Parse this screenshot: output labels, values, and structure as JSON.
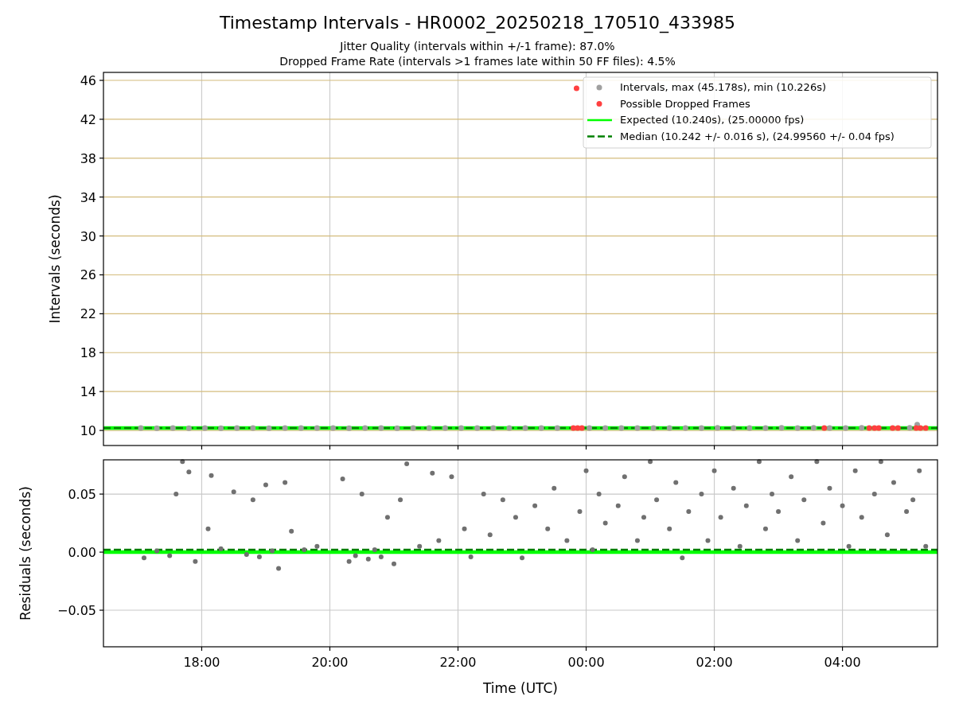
{
  "figure": {
    "title": "Timestamp Intervals - HR0002_20250218_170510_433985",
    "subtitles": [
      "Jitter Quality (intervals within +/-1 frame): 87.0%",
      "Dropped Frame Rate (intervals >1 frames late within 50 FF files): 4.5%"
    ]
  },
  "intervals_plot": {
    "chart_data": {
      "type": "scatter",
      "ylabel": "Intervals (seconds)",
      "grid": true,
      "legend": "upper right",
      "xlim": [
        "2025-02-18 16:28",
        "2025-02-19 05:29"
      ],
      "ylim": [
        8.45,
        46.82
      ],
      "yticks": [
        10,
        14,
        18,
        22,
        26,
        30,
        34,
        38,
        42,
        46
      ],
      "series": [
        {
          "name": "Intervals, max (45.178s), min (10.226s)",
          "type": "scatter",
          "color": "#a0a0a0",
          "x": [
            "2025-02-18 17:03",
            "2025-02-18 17:18",
            "2025-02-18 17:33",
            "2025-02-18 17:48",
            "2025-02-18 18:03",
            "2025-02-18 18:18",
            "2025-02-18 18:33",
            "2025-02-18 18:48",
            "2025-02-18 19:03",
            "2025-02-18 19:18",
            "2025-02-18 19:33",
            "2025-02-18 19:48",
            "2025-02-18 20:03",
            "2025-02-18 20:18",
            "2025-02-18 20:33",
            "2025-02-18 20:48",
            "2025-02-18 21:03",
            "2025-02-18 21:18",
            "2025-02-18 21:33",
            "2025-02-18 21:48",
            "2025-02-18 22:03",
            "2025-02-18 22:18",
            "2025-02-18 22:33",
            "2025-02-18 22:48",
            "2025-02-18 23:03",
            "2025-02-18 23:18",
            "2025-02-18 23:33",
            "2025-02-19 00:03",
            "2025-02-19 00:18",
            "2025-02-19 00:33",
            "2025-02-19 00:48",
            "2025-02-19 01:03",
            "2025-02-19 01:18",
            "2025-02-19 01:33",
            "2025-02-19 01:48",
            "2025-02-19 02:03",
            "2025-02-19 02:18",
            "2025-02-19 02:33",
            "2025-02-19 02:48",
            "2025-02-19 03:03",
            "2025-02-19 03:18",
            "2025-02-19 03:33",
            "2025-02-19 03:48",
            "2025-02-19 04:03",
            "2025-02-19 04:18",
            "2025-02-19 05:03",
            "2025-02-19 05:10"
          ],
          "values": [
            10.24,
            10.23,
            10.24,
            10.23,
            10.24,
            10.23,
            10.24,
            10.24,
            10.23,
            10.24,
            10.24,
            10.24,
            10.24,
            10.23,
            10.24,
            10.24,
            10.23,
            10.24,
            10.24,
            10.24,
            10.24,
            10.24,
            10.24,
            10.24,
            10.24,
            10.25,
            10.24,
            10.25,
            10.26,
            10.25,
            10.26,
            10.26,
            10.25,
            10.26,
            10.26,
            10.27,
            10.26,
            10.25,
            10.26,
            10.27,
            10.26,
            10.27,
            10.26,
            10.26,
            10.27,
            10.27,
            10.6
          ]
        },
        {
          "name": "Possible Dropped Frames",
          "type": "scatter",
          "color": "#ff4040",
          "x": [
            "2025-02-18 23:51",
            "2025-02-18 23:48",
            "2025-02-18 23:52",
            "2025-02-18 23:56",
            "2025-02-19 03:43",
            "2025-02-19 04:25",
            "2025-02-19 04:30",
            "2025-02-19 04:34",
            "2025-02-19 04:47",
            "2025-02-19 04:52",
            "2025-02-19 05:09",
            "2025-02-19 05:13",
            "2025-02-19 05:18"
          ],
          "values": [
            45.178,
            10.24,
            10.24,
            10.24,
            10.24,
            10.24,
            10.24,
            10.24,
            10.24,
            10.24,
            10.24,
            10.24,
            10.24
          ]
        },
        {
          "name": "Expected (10.240s), (25.00000 fps)",
          "type": "line",
          "color": "#00ff00",
          "x": [
            "2025-02-18 16:28",
            "2025-02-19 05:29"
          ],
          "values": [
            10.24,
            10.24
          ]
        },
        {
          "name": "Median (10.242 +/- 0.016 s), (24.99560 +/- 0.04 fps)",
          "type": "line",
          "color": "#008000",
          "line_style": "dashed",
          "x": [
            "2025-02-18 16:28",
            "2025-02-19 05:29"
          ],
          "values": [
            10.242,
            10.242
          ]
        }
      ]
    }
  },
  "residuals_plot": {
    "chart_data": {
      "type": "scatter",
      "xlabel": "Time (UTC)",
      "ylabel": "Residuals (seconds)",
      "grid": true,
      "xlim": [
        "2025-02-18 16:28",
        "2025-02-19 05:29"
      ],
      "ylim": [
        -0.0815,
        0.0795
      ],
      "xticks": [
        {
          "value": "2025-02-18 18:00",
          "label": "18:00"
        },
        {
          "value": "2025-02-18 20:00",
          "label": "20:00"
        },
        {
          "value": "2025-02-18 22:00",
          "label": "22:00"
        },
        {
          "value": "2025-02-19 00:00",
          "label": "00:00"
        },
        {
          "value": "2025-02-19 02:00",
          "label": "02:00"
        },
        {
          "value": "2025-02-19 04:00",
          "label": "04:00"
        }
      ],
      "yticks": [
        {
          "value": 0.05,
          "label": "0.05"
        },
        {
          "value": 0,
          "label": "0.00"
        },
        {
          "value": -0.05,
          "label": "−0.05"
        }
      ],
      "series": [
        {
          "type": "scatter",
          "color": "#707070",
          "x": [
            "2025-02-18 17:06",
            "2025-02-18 17:18",
            "2025-02-18 17:36",
            "2025-02-18 17:42",
            "2025-02-18 17:48",
            "2025-02-18 17:54",
            "2025-02-18 18:06",
            "2025-02-18 18:09",
            "2025-02-18 18:18",
            "2025-02-18 18:30",
            "2025-02-18 18:42",
            "2025-02-18 18:48",
            "2025-02-18 19:00",
            "2025-02-18 19:06",
            "2025-02-18 19:12",
            "2025-02-18 19:18",
            "2025-02-18 19:24",
            "2025-02-18 19:36",
            "2025-02-18 19:48",
            "2025-02-18 20:12",
            "2025-02-18 20:18",
            "2025-02-18 20:30",
            "2025-02-18 20:42",
            "2025-02-18 20:54",
            "2025-02-18 21:00",
            "2025-02-18 21:06",
            "2025-02-18 21:12",
            "2025-02-18 21:24",
            "2025-02-18 21:36",
            "2025-02-18 21:42",
            "2025-02-18 21:54",
            "2025-02-18 22:06",
            "2025-02-18 22:12",
            "2025-02-18 22:24",
            "2025-02-18 22:30",
            "2025-02-18 22:42",
            "2025-02-18 22:54",
            "2025-02-18 23:00",
            "2025-02-18 23:12",
            "2025-02-18 23:24",
            "2025-02-18 23:30",
            "2025-02-18 23:42",
            "2025-02-18 23:54",
            "2025-02-19 00:00",
            "2025-02-19 00:06",
            "2025-02-19 00:12",
            "2025-02-19 00:18",
            "2025-02-19 00:30",
            "2025-02-19 00:36",
            "2025-02-19 00:48",
            "2025-02-19 00:54",
            "2025-02-19 01:00",
            "2025-02-19 01:06",
            "2025-02-19 01:18",
            "2025-02-19 01:24",
            "2025-02-19 01:30",
            "2025-02-19 01:36",
            "2025-02-19 01:48",
            "2025-02-19 01:54",
            "2025-02-19 02:00",
            "2025-02-19 02:06",
            "2025-02-19 02:18",
            "2025-02-19 02:24",
            "2025-02-19 02:30",
            "2025-02-19 02:42",
            "2025-02-19 02:48",
            "2025-02-19 02:54",
            "2025-02-19 03:00",
            "2025-02-19 03:12",
            "2025-02-19 03:18",
            "2025-02-19 03:24",
            "2025-02-19 03:36",
            "2025-02-19 03:42",
            "2025-02-19 03:48",
            "2025-02-19 04:00",
            "2025-02-19 04:06",
            "2025-02-19 04:12",
            "2025-02-19 04:18",
            "2025-02-19 04:30",
            "2025-02-19 04:36",
            "2025-02-19 04:42",
            "2025-02-19 04:48",
            "2025-02-19 05:00",
            "2025-02-19 05:06",
            "2025-02-19 05:12",
            "2025-02-19 05:18",
            "2025-02-18 17:30",
            "2025-02-18 18:54",
            "2025-02-18 20:24",
            "2025-02-18 20:36",
            "2025-02-18 20:48"
          ],
          "values": [
            -0.005,
            0.001,
            0.05,
            0.078,
            0.069,
            -0.008,
            0.02,
            0.066,
            0.003,
            0.052,
            -0.002,
            0.045,
            0.058,
            0.001,
            -0.014,
            0.06,
            0.018,
            0.002,
            0.005,
            0.063,
            -0.008,
            0.05,
            0.002,
            0.03,
            -0.01,
            0.045,
            0.076,
            0.005,
            0.068,
            0.01,
            0.065,
            0.02,
            -0.004,
            0.05,
            0.015,
            0.045,
            0.03,
            -0.005,
            0.04,
            0.02,
            0.055,
            0.01,
            0.035,
            0.07,
            0.002,
            0.05,
            0.025,
            0.04,
            0.065,
            0.01,
            0.03,
            0.078,
            0.045,
            0.02,
            0.06,
            -0.005,
            0.035,
            0.05,
            0.01,
            0.07,
            0.03,
            0.055,
            0.005,
            0.04,
            0.078,
            0.02,
            0.05,
            0.035,
            0.065,
            0.01,
            0.045,
            0.078,
            0.025,
            0.055,
            0.04,
            0.005,
            0.07,
            0.03,
            0.05,
            0.078,
            0.015,
            0.06,
            0.035,
            0.045,
            0.07,
            0.005,
            -0.003,
            -0.004,
            -0.003,
            -0.006,
            -0.004
          ]
        },
        {
          "type": "line",
          "color": "#00ff00",
          "x": [
            "2025-02-18 16:28",
            "2025-02-19 05:29"
          ],
          "values": [
            0,
            0
          ]
        },
        {
          "type": "line",
          "color": "#008000",
          "line_style": "dashed",
          "x": [
            "2025-02-18 16:28",
            "2025-02-19 05:29"
          ],
          "values": [
            0.002,
            0.002
          ]
        }
      ]
    }
  }
}
